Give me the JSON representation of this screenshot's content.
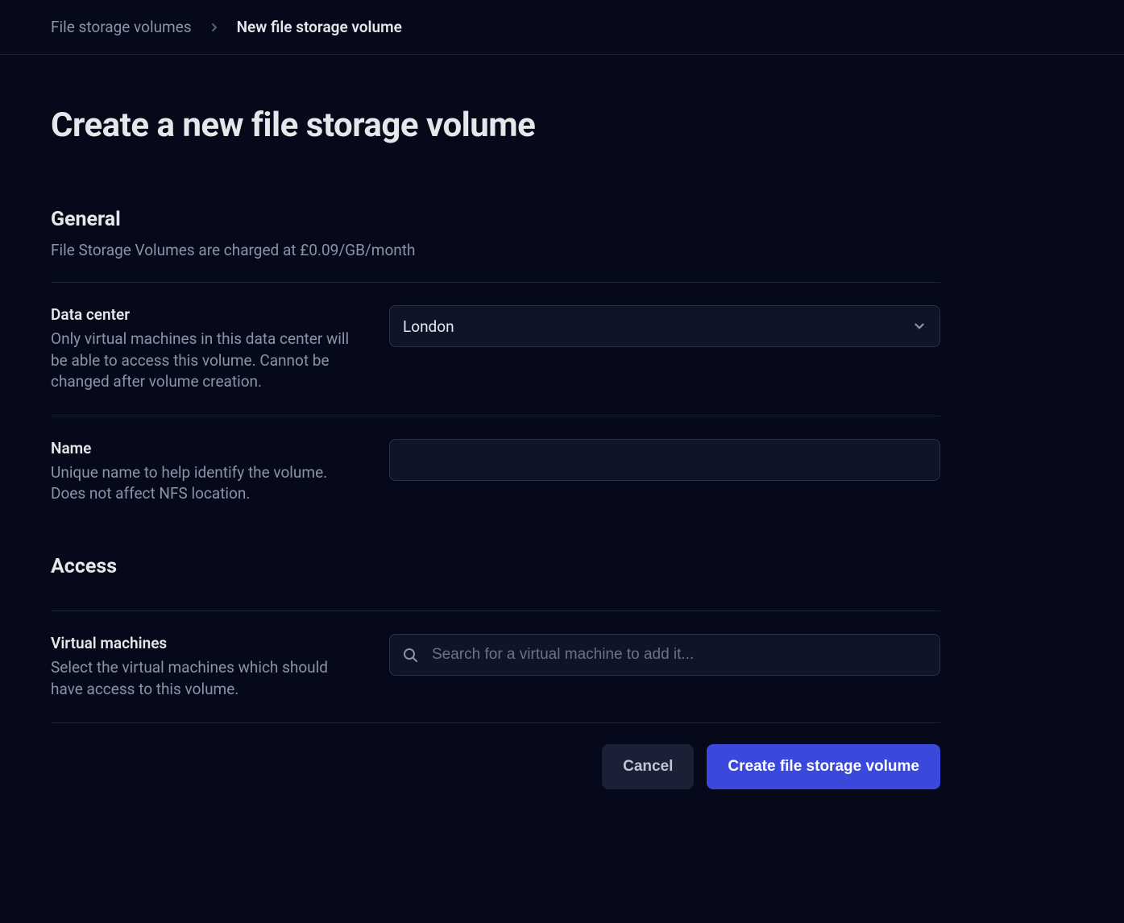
{
  "breadcrumb": {
    "parent": "File storage volumes",
    "current": "New file storage volume"
  },
  "page_title": "Create a new file storage volume",
  "sections": {
    "general": {
      "heading": "General",
      "subtext": "File Storage Volumes are charged at £0.09/GB/month",
      "fields": {
        "data_center": {
          "label": "Data center",
          "helper": "Only virtual machines in this data center will be able to access this volume. Cannot be changed after volume creation.",
          "value": "London"
        },
        "name": {
          "label": "Name",
          "helper": "Unique name to help identify the volume. Does not affect NFS location.",
          "value": ""
        }
      }
    },
    "access": {
      "heading": "Access",
      "fields": {
        "virtual_machines": {
          "label": "Virtual machines",
          "helper": "Select the virtual machines which should have access to this volume.",
          "placeholder": "Search for a virtual machine to add it..."
        }
      }
    }
  },
  "buttons": {
    "cancel": "Cancel",
    "submit": "Create file storage volume"
  }
}
